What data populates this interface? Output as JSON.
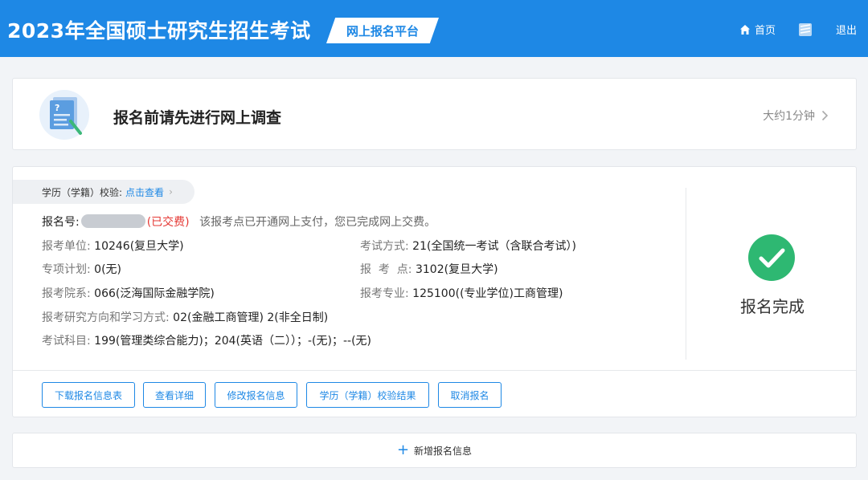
{
  "header": {
    "title": "2023年全国硕士研究生招生考试",
    "platform": "网上报名平台",
    "home": "首页",
    "logout": "退出"
  },
  "survey": {
    "title": "报名前请先进行网上调查",
    "time": "大约1分钟"
  },
  "registration": {
    "verify_label": "学历（学籍）校验:",
    "verify_link": "点击查看",
    "reg_no_label": "报名号:",
    "paid_status": "(已交费)",
    "pay_note": "该报考点已开通网上支付，您已完成网上交费。",
    "fields": {
      "unit_label": "报考单位:",
      "unit_value": "10246(复旦大学)",
      "exam_mode_label": "考试方式:",
      "exam_mode_value": "21(全国统一考试（含联合考试）)",
      "plan_label": "专项计划:",
      "plan_value": "0(无)",
      "site_label": "报  考  点:",
      "site_value": "3102(复旦大学)",
      "dept_label": "报考院系:",
      "dept_value": "066(泛海国际金融学院)",
      "major_label": "报考专业:",
      "major_value": "125100((专业学位)工商管理)",
      "direction_label": "报考研究方向和学习方式:",
      "direction_value": "02(金融工商管理) 2(非全日制)",
      "subjects_label": "考试科目:",
      "subjects_value": "199(管理类综合能力)；204(英语（二））；-(无)；--(无)"
    },
    "status": "报名完成",
    "buttons": {
      "download": "下载报名信息表",
      "details": "查看详细",
      "edit": "修改报名信息",
      "verify_result": "学历（学籍）校验结果",
      "cancel": "取消报名"
    }
  },
  "add_new": "新增报名信息",
  "colors": {
    "primary": "#1e88e5",
    "success": "#2eb872",
    "paid": "#e53935"
  }
}
